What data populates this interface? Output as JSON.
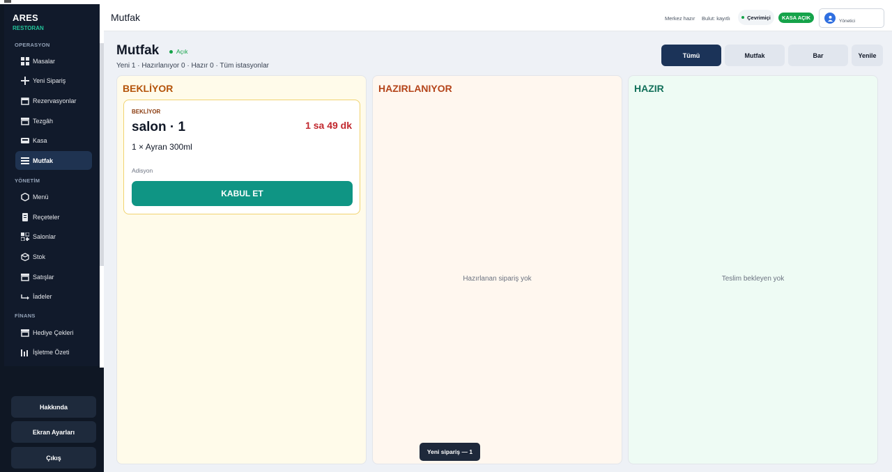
{
  "window": {
    "title": "Ares Restoran"
  },
  "brand": {
    "name": "ARES",
    "sub": "RESTORAN"
  },
  "sidebar": {
    "sections": [
      {
        "label": "OPERASYON"
      },
      {
        "label": "YÖNETİM"
      },
      {
        "label": "FİNANS"
      }
    ],
    "items": [
      {
        "label": "Masalar",
        "icon": "grid-icon"
      },
      {
        "label": "Yeni Sipariş",
        "icon": "plus-icon"
      },
      {
        "label": "Rezervasyonlar",
        "icon": "calendar-icon"
      },
      {
        "label": "Tezgâh",
        "icon": "store-icon"
      },
      {
        "label": "Kasa",
        "icon": "register-icon"
      },
      {
        "label": "Mutfak",
        "icon": "menu-lines-icon",
        "active": true
      },
      {
        "label": "Menü",
        "icon": "hexagon-icon"
      },
      {
        "label": "Reçeteler",
        "icon": "document-icon"
      },
      {
        "label": "Salonlar",
        "icon": "floorplan-icon"
      },
      {
        "label": "Stok",
        "icon": "box-icon"
      },
      {
        "label": "Satışlar",
        "icon": "store-icon"
      },
      {
        "label": "İadeler",
        "icon": "return-icon"
      },
      {
        "label": "Hediye Çekleri",
        "icon": "gift-icon"
      },
      {
        "label": "İşletme Özeti",
        "icon": "bar-chart-icon"
      }
    ],
    "bottom": {
      "about": "Hakkında",
      "screen_settings": "Ekran Ayarları",
      "logout": "Çıkış"
    }
  },
  "header": {
    "title": "Mutfak",
    "merkez": "Merkez hazır",
    "bulut": "Bulut: kayıtlı",
    "online": "Çevrimiçi",
    "kasa": "KASA AÇIK",
    "user_role": "Yönetici"
  },
  "page": {
    "title": "Mutfak",
    "status": "Açık",
    "summary": "Yeni 1 · Hazırlanıyor 0 · Hazır 0  ·  Tüm istasyonlar",
    "filters": [
      {
        "label": "Tümü",
        "active": true
      },
      {
        "label": "Mutfak"
      },
      {
        "label": "Bar"
      },
      {
        "label": "Yenile"
      }
    ]
  },
  "columns": {
    "waiting": {
      "title": "BEKLİYOR"
    },
    "preparing": {
      "title": "HAZIRLANIYOR",
      "empty": "Hazırlanan sipariş yok"
    },
    "ready": {
      "title": "HAZIR",
      "empty": "Teslim bekleyen yok"
    }
  },
  "order": {
    "status": "BEKLİYOR",
    "table": "salon · 1",
    "elapsed": "1 sa 49 dk",
    "item": "1 × Ayran 300ml",
    "type": "Adisyon",
    "accept": "KABUL ET"
  },
  "toast": {
    "text": "Yeni sipariş — 1"
  },
  "colors": {
    "sidebar": "#0f1724",
    "accent_green": "#22c39a",
    "primary_dark": "#1b3358",
    "accept": "#0f9584",
    "waiting_bg": "#fffbea",
    "preparing_bg": "#fff7ef",
    "ready_bg": "#eefbf4",
    "waiting_title": "#b45309",
    "preparing_title": "#b4441a",
    "ready_title": "#12705a",
    "timer": "#c1272d"
  }
}
